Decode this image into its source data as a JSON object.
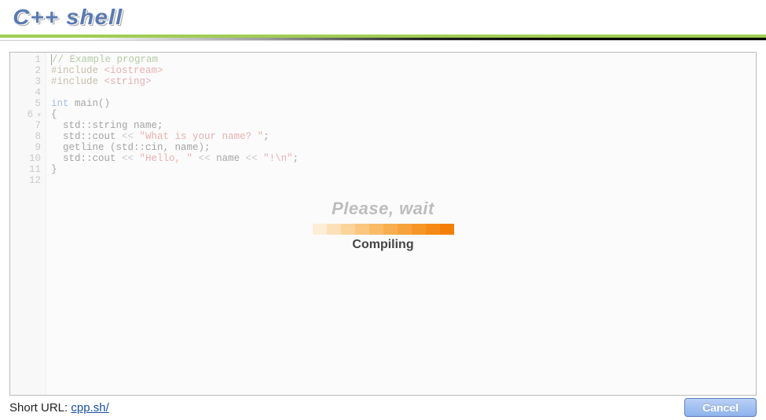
{
  "header": {
    "logo": "C++ shell"
  },
  "editor": {
    "line_numbers": [
      "1",
      "2",
      "3",
      "4",
      "5",
      "6",
      "7",
      "8",
      "9",
      "10",
      "11",
      "12"
    ],
    "fold_line_index": 5,
    "code_lines": [
      {
        "tokens": [
          {
            "t": "// Example program",
            "c": "c-comment"
          }
        ]
      },
      {
        "tokens": [
          {
            "t": "#include ",
            "c": "c-pp"
          },
          {
            "t": "<iostream>",
            "c": "c-inc"
          }
        ]
      },
      {
        "tokens": [
          {
            "t": "#include ",
            "c": "c-pp"
          },
          {
            "t": "<string>",
            "c": "c-inc"
          }
        ]
      },
      {
        "tokens": [
          {
            "t": "",
            "c": ""
          }
        ]
      },
      {
        "tokens": [
          {
            "t": "int",
            "c": "c-kw"
          },
          {
            "t": " main()",
            "c": "c-id"
          }
        ]
      },
      {
        "tokens": [
          {
            "t": "{",
            "c": "c-id"
          }
        ]
      },
      {
        "tokens": [
          {
            "t": "  std::string name;",
            "c": "c-id"
          }
        ]
      },
      {
        "tokens": [
          {
            "t": "  std::cout ",
            "c": "c-id"
          },
          {
            "t": "<<",
            "c": "c-op"
          },
          {
            "t": " ",
            "c": ""
          },
          {
            "t": "\"What is your name? \"",
            "c": "c-str"
          },
          {
            "t": ";",
            "c": "c-id"
          }
        ]
      },
      {
        "tokens": [
          {
            "t": "  getline (std::cin, name);",
            "c": "c-id"
          }
        ]
      },
      {
        "tokens": [
          {
            "t": "  std::cout ",
            "c": "c-id"
          },
          {
            "t": "<<",
            "c": "c-op"
          },
          {
            "t": " ",
            "c": ""
          },
          {
            "t": "\"Hello, \"",
            "c": "c-str"
          },
          {
            "t": " ",
            "c": ""
          },
          {
            "t": "<<",
            "c": "c-op"
          },
          {
            "t": " name ",
            "c": "c-id"
          },
          {
            "t": "<<",
            "c": "c-op"
          },
          {
            "t": " ",
            "c": ""
          },
          {
            "t": "\"!\\n\"",
            "c": "c-str"
          },
          {
            "t": ";",
            "c": "c-id"
          }
        ]
      },
      {
        "tokens": [
          {
            "t": "}",
            "c": "c-id"
          }
        ]
      },
      {
        "tokens": [
          {
            "t": "",
            "c": ""
          }
        ]
      }
    ]
  },
  "overlay": {
    "title": "Please, wait",
    "status": "Compiling",
    "progress_colors": [
      "#fdeed7",
      "#fce0b8",
      "#fbd49a",
      "#fac77f",
      "#f9bb66",
      "#f8ae4f",
      "#f7a23a",
      "#f69627",
      "#f58a16",
      "#f57e06"
    ]
  },
  "footer": {
    "short_url_label": "Short URL: ",
    "short_url_text": "cpp.sh/",
    "cancel_label": "Cancel"
  }
}
